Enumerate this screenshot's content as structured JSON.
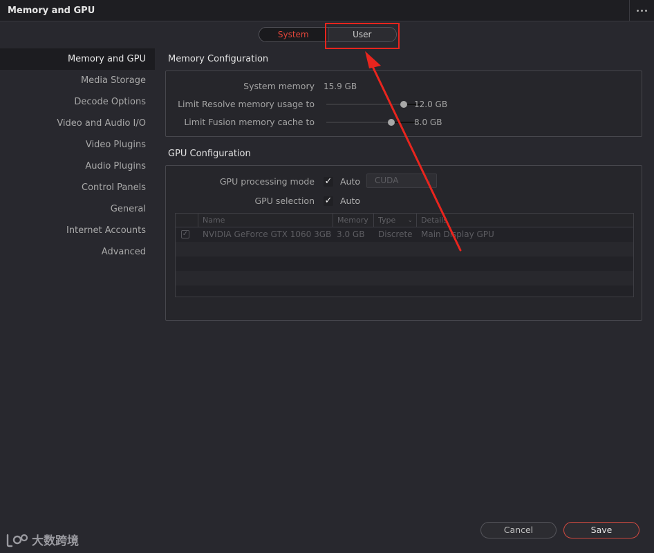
{
  "window": {
    "title": "Memory and GPU"
  },
  "tabs": {
    "system": "System",
    "user": "User"
  },
  "sidebar": {
    "items": [
      {
        "label": "Memory and GPU"
      },
      {
        "label": "Media Storage"
      },
      {
        "label": "Decode Options"
      },
      {
        "label": "Video and Audio I/O"
      },
      {
        "label": "Video Plugins"
      },
      {
        "label": "Audio Plugins"
      },
      {
        "label": "Control Panels"
      },
      {
        "label": "General"
      },
      {
        "label": "Internet Accounts"
      },
      {
        "label": "Advanced"
      }
    ]
  },
  "memory": {
    "title": "Memory Configuration",
    "system_memory_label": "System memory",
    "system_memory_value": "15.9 GB",
    "resolve_label": "Limit Resolve memory usage to",
    "resolve_value": "12.0 GB",
    "resolve_fraction": 0.82,
    "fusion_label": "Limit Fusion memory cache to",
    "fusion_value": "8.0 GB",
    "fusion_fraction": 0.69
  },
  "gpu": {
    "title": "GPU Configuration",
    "mode_label": "GPU processing mode",
    "mode_auto": "Auto",
    "mode_select": "CUDA",
    "selection_label": "GPU selection",
    "selection_auto": "Auto",
    "columns": {
      "name": "Name",
      "memory": "Memory",
      "type": "Type",
      "details": "Details"
    },
    "rows": [
      {
        "name": "NVIDIA GeForce GTX 1060 3GB",
        "memory": "3.0 GB",
        "type": "Discrete",
        "details": "Main Display GPU"
      }
    ]
  },
  "footer": {
    "cancel": "Cancel",
    "save": "Save"
  },
  "watermark": {
    "text": "大数跨境"
  },
  "colors": {
    "accent": "#e0453a",
    "annotation": "#e8251e"
  }
}
